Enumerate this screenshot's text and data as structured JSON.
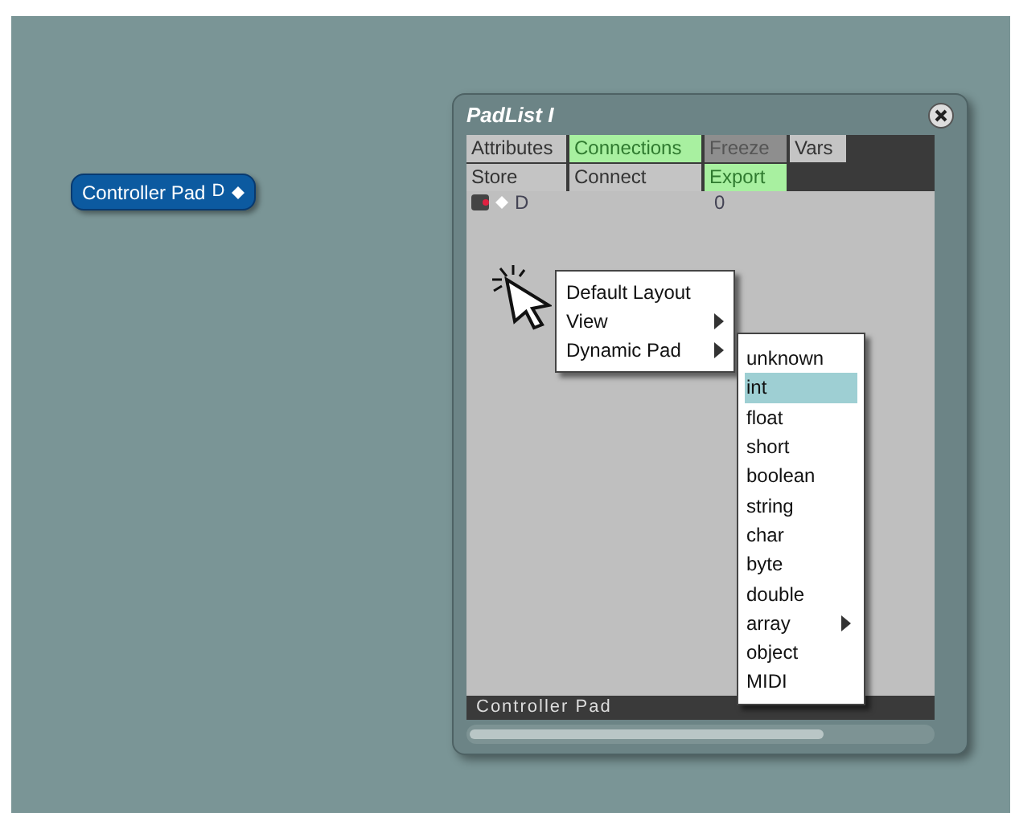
{
  "node": {
    "label": "Controller Pad",
    "port": "D"
  },
  "window": {
    "title": "PadList I",
    "tab_rows": [
      [
        {
          "label": "Attributes",
          "highlighted": false,
          "disabled": false
        },
        {
          "label": "Connections",
          "highlighted": true,
          "disabled": false
        },
        {
          "label": "Freeze",
          "highlighted": false,
          "disabled": true
        },
        {
          "label": "Vars",
          "highlighted": false,
          "disabled": false
        }
      ],
      [
        {
          "label": "Store",
          "highlighted": false,
          "disabled": false
        },
        {
          "label": "Connect",
          "highlighted": false,
          "disabled": false
        },
        {
          "label": "Export",
          "highlighted": true,
          "disabled": false
        }
      ]
    ],
    "pad_row": {
      "name": "D",
      "value": "0"
    },
    "status_bar": "Controller Pad"
  },
  "context_menu": [
    {
      "label": "Default Layout",
      "submenu": false
    },
    {
      "label": "View",
      "submenu": true
    },
    {
      "label": "Dynamic Pad",
      "submenu": true
    }
  ],
  "submenu": [
    {
      "label": "unknown",
      "selected": false,
      "submenu": false
    },
    {
      "label": "int",
      "selected": true,
      "submenu": false
    },
    {
      "label": "float",
      "selected": false,
      "submenu": false
    },
    {
      "label": "short",
      "selected": false,
      "submenu": false
    },
    {
      "label": "boolean",
      "selected": false,
      "submenu": false
    },
    {
      "label": "string",
      "selected": false,
      "submenu": false
    },
    {
      "label": "char",
      "selected": false,
      "submenu": false
    },
    {
      "label": "byte",
      "selected": false,
      "submenu": false
    },
    {
      "label": "double",
      "selected": false,
      "submenu": false
    },
    {
      "label": "array",
      "selected": false,
      "submenu": true
    },
    {
      "label": "object",
      "selected": false,
      "submenu": false
    },
    {
      "label": "MIDI",
      "selected": false,
      "submenu": false
    }
  ]
}
